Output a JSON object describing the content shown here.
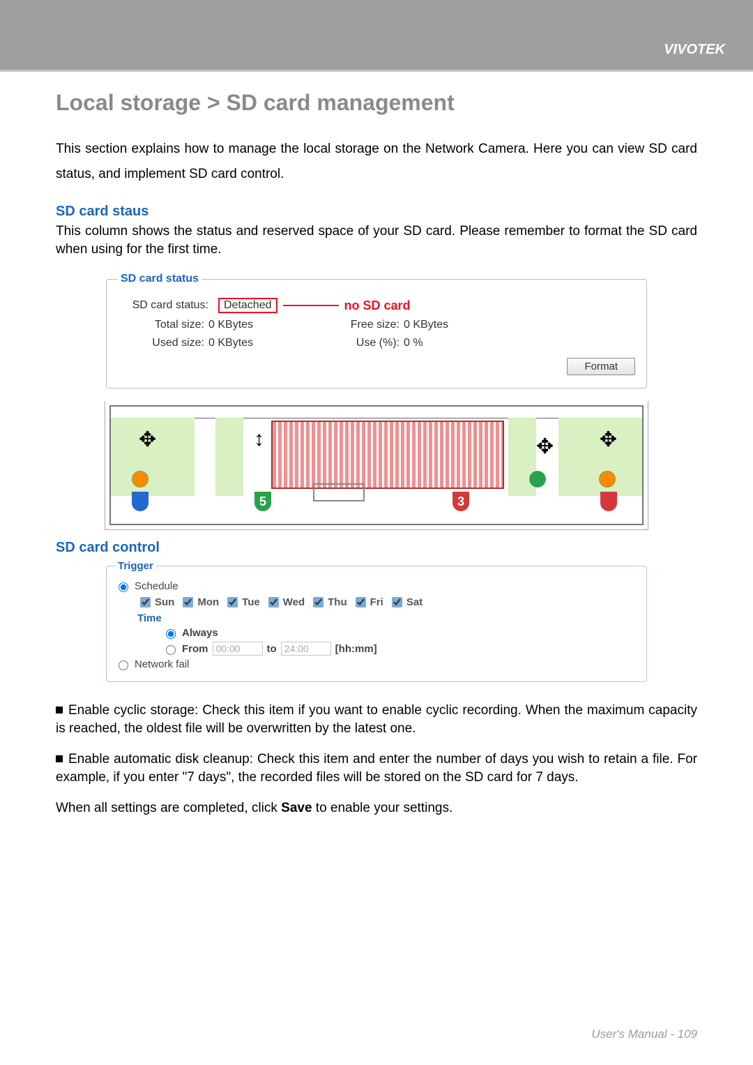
{
  "brand": "VIVOTEK",
  "title": "Local storage > SD card management",
  "intro": "This section explains how to manage the local storage on the Network Camera. Here you can view SD card status, and implement SD card control.",
  "section_status_title": "SD card staus",
  "section_status_desc": "This column shows the status and reserved space of your SD card. Please remember to format the SD card when using for the first time.",
  "status_panel": {
    "legend": "SD card status",
    "status_label": "SD card status:",
    "status_value": "Detached",
    "no_sd_text": "no SD card",
    "total_label": "Total size:",
    "total_value": "0  KBytes",
    "free_label": "Free size:",
    "free_value": "0  KBytes",
    "used_label": "Used size:",
    "used_value": "0  KBytes",
    "usepct_label": "Use (%):",
    "usepct_value": "0 %",
    "format_btn": "Format"
  },
  "section_control_title": "SD card control",
  "trigger_panel": {
    "legend": "Trigger",
    "schedule_label": "Schedule",
    "days": [
      "Sun",
      "Mon",
      "Tue",
      "Wed",
      "Thu",
      "Fri",
      "Sat"
    ],
    "time_label": "Time",
    "always_label": "Always",
    "from_label": "From",
    "from_value": "00:00",
    "to_label": "to",
    "to_value": "24:00",
    "hhmm": "[hh:mm]",
    "network_fail_label": "Network fail"
  },
  "bullets": [
    "Enable cyclic storage: Check this item if you want to enable cyclic recording. When the maximum capacity is reached, the oldest file will be overwritten by the latest one.",
    "Enable automatic disk cleanup: Check this item and enter the number of days you wish to retain a file. For example, if you enter \"7 days\", the recorded files will be stored on the SD card for 7 days."
  ],
  "closing_pre": "When all settings are completed, click ",
  "closing_bold": "Save",
  "closing_post": " to enable your settings.",
  "footer_label": "User's Manual - ",
  "footer_page": "109"
}
